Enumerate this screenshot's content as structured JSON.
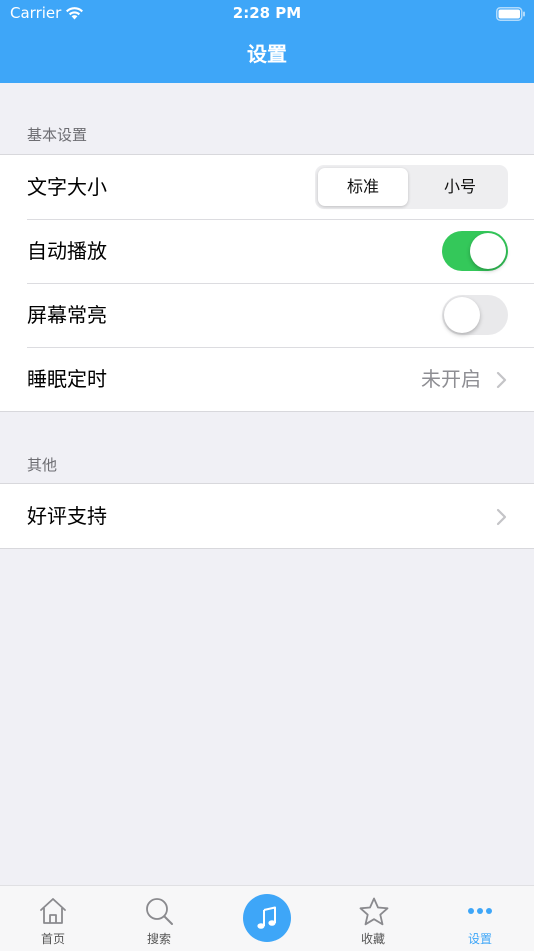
{
  "status_bar": {
    "carrier": "Carrier",
    "time": "2:28 PM"
  },
  "nav": {
    "title": "设置",
    "color": "#3ea6f8"
  },
  "sections": [
    {
      "header": "基本设置",
      "rows": [
        {
          "label": "文字大小",
          "segments": [
            "标准",
            "小号"
          ],
          "selected": "标准"
        },
        {
          "label": "自动播放",
          "toggle": true
        },
        {
          "label": "屏幕常亮",
          "toggle": false
        },
        {
          "label": "睡眠定时",
          "value": "未开启",
          "icon": "chevron-right-icon"
        }
      ]
    },
    {
      "header": "其他",
      "rows": [
        {
          "label": "好评支持",
          "icon": "chevron-right-icon"
        }
      ]
    }
  ],
  "tab_bar": {
    "tabs": [
      {
        "label": "首页",
        "icon": "home-icon"
      },
      {
        "label": "搜索",
        "icon": "search-icon"
      },
      {
        "label": "",
        "icon": "music-note-icon"
      },
      {
        "label": "收藏",
        "icon": "star-icon"
      },
      {
        "label": "设置",
        "icon": "more-icon",
        "selected": true
      }
    ],
    "accent_color": "#3ea6f8"
  },
  "colors": {
    "toggle_on": "#34c85a",
    "background": "#f0f0f5"
  }
}
